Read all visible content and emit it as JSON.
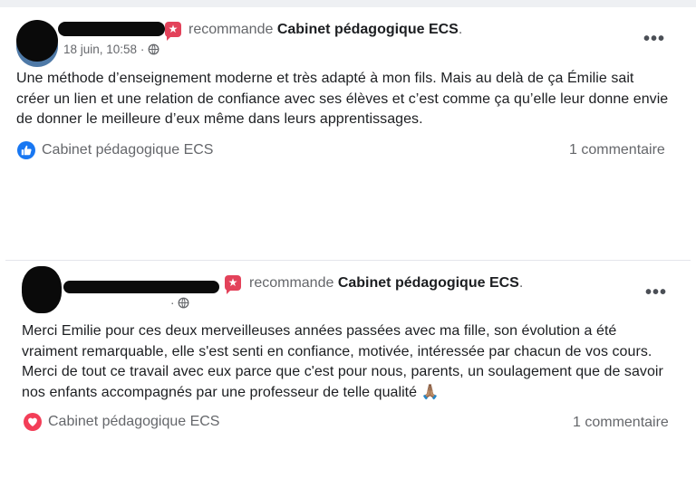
{
  "posts": [
    {
      "recommends_label": "recommande",
      "page_name": "Cabinet pédagogique ECS",
      "suffix": ".",
      "date": "18 juin, 10:58 ·",
      "body": "Une méthode d’enseignement moderne et très adapté à mon fils. Mais au delà de ça Émilie sait créer un lien et une relation de confiance avec ses élèves et c’est comme ça qu’elle leur donne envie de donner le meilleure d’eux même dans leurs apprentissages.",
      "reaction_label": "Cabinet pédagogique ECS",
      "reaction_icon": "like-icon",
      "reaction_color": "#1877f2",
      "comments": "1 commentaire",
      "more": "•••"
    },
    {
      "recommends_label": "recommande",
      "page_name": "Cabinet pédagogique ECS",
      "suffix": ".",
      "date": "·",
      "body": "Merci Emilie pour ces deux merveilleuses années passées avec ma fille,  son évolution a été vraiment remarquable,  elle s'est senti en confiance, motivée, intéressée par chacun de vos cours. Merci de tout ce travail avec eux parce que c'est pour nous, parents, un soulagement que de savoir nos enfants accompagnés par une professeur de telle qualité 🙏🏽",
      "reaction_label": "Cabinet pédagogique ECS",
      "reaction_icon": "heart-icon",
      "reaction_color": "#f33e58",
      "comments": "1 commentaire",
      "more": "•••"
    }
  ],
  "colors": {
    "recommend_badge": "#e3425a",
    "secondary_text": "#65676b"
  }
}
